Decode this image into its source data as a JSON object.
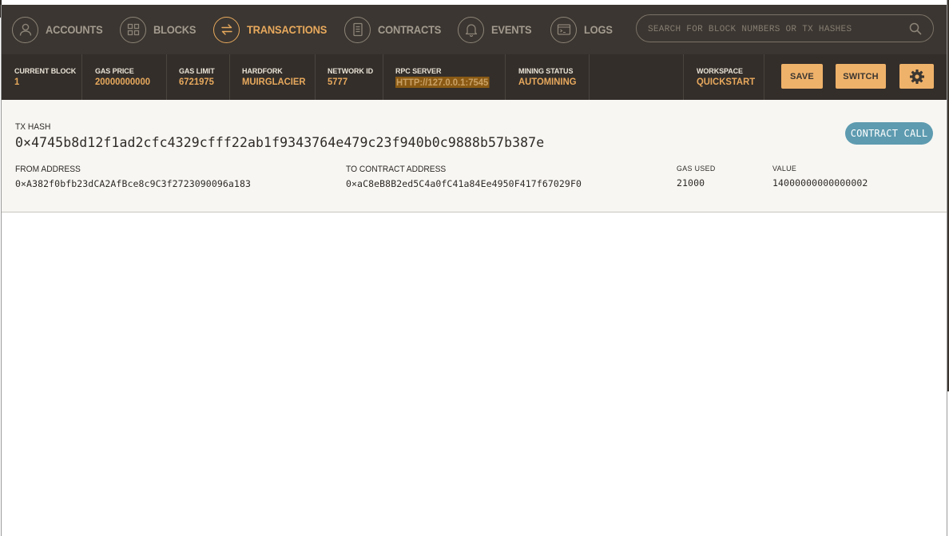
{
  "nav": {
    "items": [
      {
        "label": "ACCOUNTS",
        "icon": "user-icon",
        "active": false
      },
      {
        "label": "BLOCKS",
        "icon": "grid-icon",
        "active": false
      },
      {
        "label": "TRANSACTIONS",
        "icon": "swap-arrows-icon",
        "active": true
      },
      {
        "label": "CONTRACTS",
        "icon": "document-icon",
        "active": false
      },
      {
        "label": "EVENTS",
        "icon": "bell-icon",
        "active": false
      },
      {
        "label": "LOGS",
        "icon": "terminal-icon",
        "active": false
      }
    ],
    "search": {
      "placeholder": "SEARCH FOR BLOCK NUMBERS OR TX HASHES"
    }
  },
  "status": {
    "current_block": {
      "label": "CURRENT BLOCK",
      "value": "1"
    },
    "gas_price": {
      "label": "GAS PRICE",
      "value": "20000000000"
    },
    "gas_limit": {
      "label": "GAS LIMIT",
      "value": "6721975"
    },
    "hardfork": {
      "label": "HARDFORK",
      "value": "MUIRGLACIER"
    },
    "network_id": {
      "label": "NETWORK ID",
      "value": "5777"
    },
    "rpc_server": {
      "label": "RPC SERVER",
      "value": "HTTP://127.0.0.1:7545"
    },
    "mining_status": {
      "label": "MINING STATUS",
      "value": "AUTOMINING"
    },
    "workspace": {
      "label": "WORKSPACE",
      "value": "QUICKSTART"
    },
    "save_label": "SAVE",
    "switch_label": "SWITCH"
  },
  "tx": {
    "hash_label": "TX HASH",
    "hash": "0×4745b8d12f1ad2cfc4329cfff22ab1f9343764e479c23f940b0c9888b57b387e",
    "badge": "CONTRACT CALL",
    "from_label": "FROM ADDRESS",
    "from": "0×A382f0bfb23dCA2AfBce8c9C3f2723090096a183",
    "to_label": "TO CONTRACT ADDRESS",
    "to": "0×aC8eB8B2ed5C4a0fC41a84Ee4950F417f67029F0",
    "gas_used_label": "GAS USED",
    "gas_used": "21000",
    "value_label": "VALUE",
    "value": "14000000000000002"
  },
  "colors": {
    "nav_bg": "#3b3631",
    "status_bg": "#332e2a",
    "accent": "#e8a95d",
    "badge": "#5e9bb0"
  }
}
